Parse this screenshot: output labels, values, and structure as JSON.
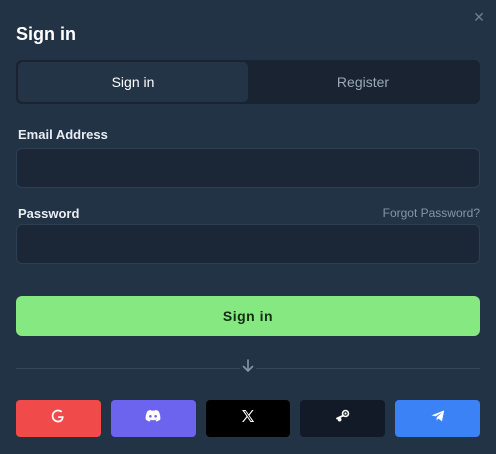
{
  "dialog": {
    "title": "Sign in",
    "close_icon": "close-icon"
  },
  "tabs": [
    {
      "label": "Sign in",
      "active": true
    },
    {
      "label": "Register",
      "active": false
    }
  ],
  "form": {
    "email_label": "Email Address",
    "email_value": "",
    "password_label": "Password",
    "password_value": "",
    "forgot_label": "Forgot Password?",
    "submit_label": "Sign in"
  },
  "divider_icon": "arrow-down-icon",
  "social_buttons": [
    {
      "provider": "google",
      "icon": "google-icon",
      "color": "#f04a4a"
    },
    {
      "provider": "discord",
      "icon": "discord-icon",
      "color": "#6c63ee"
    },
    {
      "provider": "x",
      "icon": "x-icon",
      "color": "#000000"
    },
    {
      "provider": "steam",
      "icon": "steam-icon",
      "color": "#121a27"
    },
    {
      "provider": "telegram",
      "icon": "telegram-icon",
      "color": "#3b82f6"
    }
  ],
  "colors": {
    "background": "#233346",
    "accent": "#86e880",
    "input_bg": "#1b2636"
  }
}
